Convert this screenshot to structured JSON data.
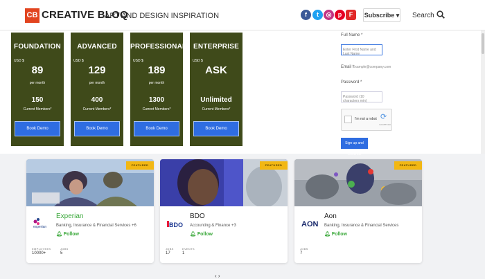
{
  "header": {
    "logo_badge": "CB",
    "logo_word": "CREATIVE BLOQ",
    "tagline": "ART AND DESIGN INSPIRATION",
    "social_icons": [
      "facebook-icon",
      "twitter-icon",
      "instagram-icon",
      "pinterest-icon",
      "flipboard-icon"
    ],
    "subscribe_label": "Subscribe ▾",
    "search_label": "Search"
  },
  "colors": {
    "brand": "#e2441f",
    "plan_bg": "#3f4a1a",
    "button_blue": "#2f6de1",
    "featured_badge": "#f2b713",
    "follow_green": "#3aa83a"
  },
  "plans": [
    {
      "name": "FOUNDATION",
      "currency": "USD $",
      "price": "89",
      "period": "per month",
      "count": "150",
      "count_label": "Current Members*",
      "button": "Book Demo"
    },
    {
      "name": "ADVANCED",
      "currency": "USD $",
      "price": "129",
      "period": "per month",
      "count": "400",
      "count_label": "Current Members*",
      "button": "Book Demo"
    },
    {
      "name": "PROFESSIONAL",
      "currency": "USD $",
      "price": "189",
      "period": "per month",
      "count": "1300",
      "count_label": "Current Members*",
      "button": "Book Demo"
    },
    {
      "name": "ENTERPRISE",
      "currency": "USD $",
      "price": "ASK",
      "period": "",
      "count": "Unlimited",
      "count_label": "Current Members*",
      "button": "Book Demo"
    }
  ],
  "form": {
    "full_name_label": "Full Name *",
    "full_name_placeholder": "Enter First Name and Last Name",
    "email_label": "Email *",
    "email_placeholder": "Example@company.com",
    "password_label": "Password *",
    "password_placeholder": "Password (10 characters min)",
    "captcha_text": "I'm not a robot",
    "captcha_brand": "reCAPTCHA",
    "signup_label": "Sign up and Continue"
  },
  "companies": [
    {
      "name": "Experian",
      "industry": "Banking, Insurance & Financial Services +6",
      "follow": "Follow",
      "badge": "FEATURED",
      "stats": [
        {
          "label": "EMPLOYEES",
          "value": "10000+"
        },
        {
          "label": "JOBS",
          "value": "5"
        }
      ],
      "logo_text": "experian",
      "name_color": "#26478d"
    },
    {
      "name": "BDO",
      "industry": "Accounting & Finance +3",
      "follow": "Follow",
      "badge": "FEATURED",
      "stats": [
        {
          "label": "JOBS",
          "value": "17"
        },
        {
          "label": "EVENTS",
          "value": "1"
        }
      ],
      "logo_text": "BDO",
      "name_color": "#222222"
    },
    {
      "name": "Aon",
      "industry": "Banking, Insurance & Financial Services",
      "follow": "Follow",
      "badge": "FEATURED",
      "stats": [
        {
          "label": "JOBS",
          "value": "7"
        }
      ],
      "logo_text": "AON",
      "name_color": "#222222"
    }
  ],
  "pager": "‹ ›"
}
